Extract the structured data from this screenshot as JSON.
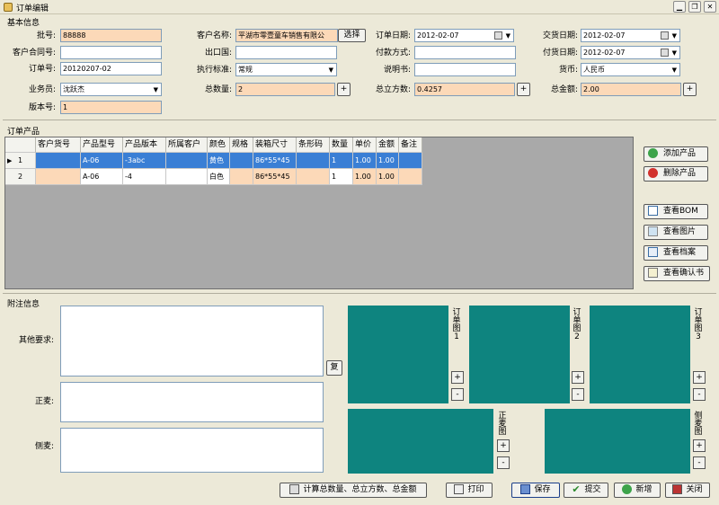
{
  "window": {
    "title": "订单编辑"
  },
  "sections": {
    "basic": "基本信息",
    "products": "订单产品",
    "notes": "附注信息"
  },
  "form": {
    "batch_no": {
      "label": "批号:",
      "value": "88888"
    },
    "contract_no": {
      "label": "客户合同号:",
      "value": ""
    },
    "order_no": {
      "label": "订单号:",
      "value": "20120207-02"
    },
    "salesman": {
      "label": "业务员:",
      "value": "沈跃杰"
    },
    "version": {
      "label": "版本号:",
      "value": "1"
    },
    "customer": {
      "label": "客户名称:",
      "value": "平湖市零壹童车销售有限公",
      "button": "选择"
    },
    "export_country": {
      "label": "出口国:",
      "value": ""
    },
    "standard": {
      "label": "执行标准:",
      "value": "常规"
    },
    "total_qty": {
      "label": "总数量:",
      "value": "2",
      "button": "+"
    },
    "order_date": {
      "label": "订单日期:",
      "value": "2012-02-07"
    },
    "payment": {
      "label": "付款方式:",
      "value": ""
    },
    "manual": {
      "label": "说明书:",
      "value": ""
    },
    "total_volume": {
      "label": "总立方数:",
      "value": "0.4257",
      "button": "+"
    },
    "delivery_date": {
      "label": "交货日期:",
      "value": "2012-02-07"
    },
    "ship_date": {
      "label": "付货日期:",
      "value": "2012-02-07"
    },
    "currency": {
      "label": "货币:",
      "value": "人民币"
    },
    "total_amount": {
      "label": "总金额:",
      "value": "2.00",
      "button": "+"
    }
  },
  "grid": {
    "columns": [
      "客户货号",
      "产品型号",
      "产品版本",
      "所属客户",
      "颜色",
      "规格",
      "装箱尺寸",
      "条形码",
      "数量",
      "单价",
      "金额",
      "备注"
    ],
    "rows": [
      {
        "no": "1",
        "cells": [
          "",
          "A-06",
          "-3abc",
          "",
          "黄色",
          "",
          "86*55*45",
          "",
          "1",
          "1.00",
          "1.00",
          ""
        ]
      },
      {
        "no": "2",
        "cells": [
          "",
          "A-06",
          "-4",
          "",
          "白色",
          "",
          "86*55*45",
          "",
          "1",
          "1.00",
          "1.00",
          ""
        ]
      }
    ]
  },
  "side_buttons": {
    "add": "添加产品",
    "delete": "删除产品",
    "bom": "查看BOM",
    "image": "查看图片",
    "archive": "查看档案",
    "confirm": "查看确认书"
  },
  "notes": {
    "other": "其他要求:",
    "front": "正麦:",
    "side": "侧麦:",
    "copy_button": "复"
  },
  "pictures": {
    "order1": "订单图1",
    "order2": "订单图2",
    "order3": "订单图3",
    "front": "正麦图",
    "side": "侧麦图",
    "plus": "+",
    "minus": "-"
  },
  "bottom": {
    "calc": "计算总数量、总立方数、总金额",
    "print": "打印",
    "save": "保存",
    "submit": "提交",
    "new": "新增",
    "close": "关闭"
  },
  "colors": {
    "required": "#fcd9b8",
    "selected_row": "#3a7fd5",
    "picture": "#0e847f",
    "grid_bg": "#a9a9a9"
  }
}
